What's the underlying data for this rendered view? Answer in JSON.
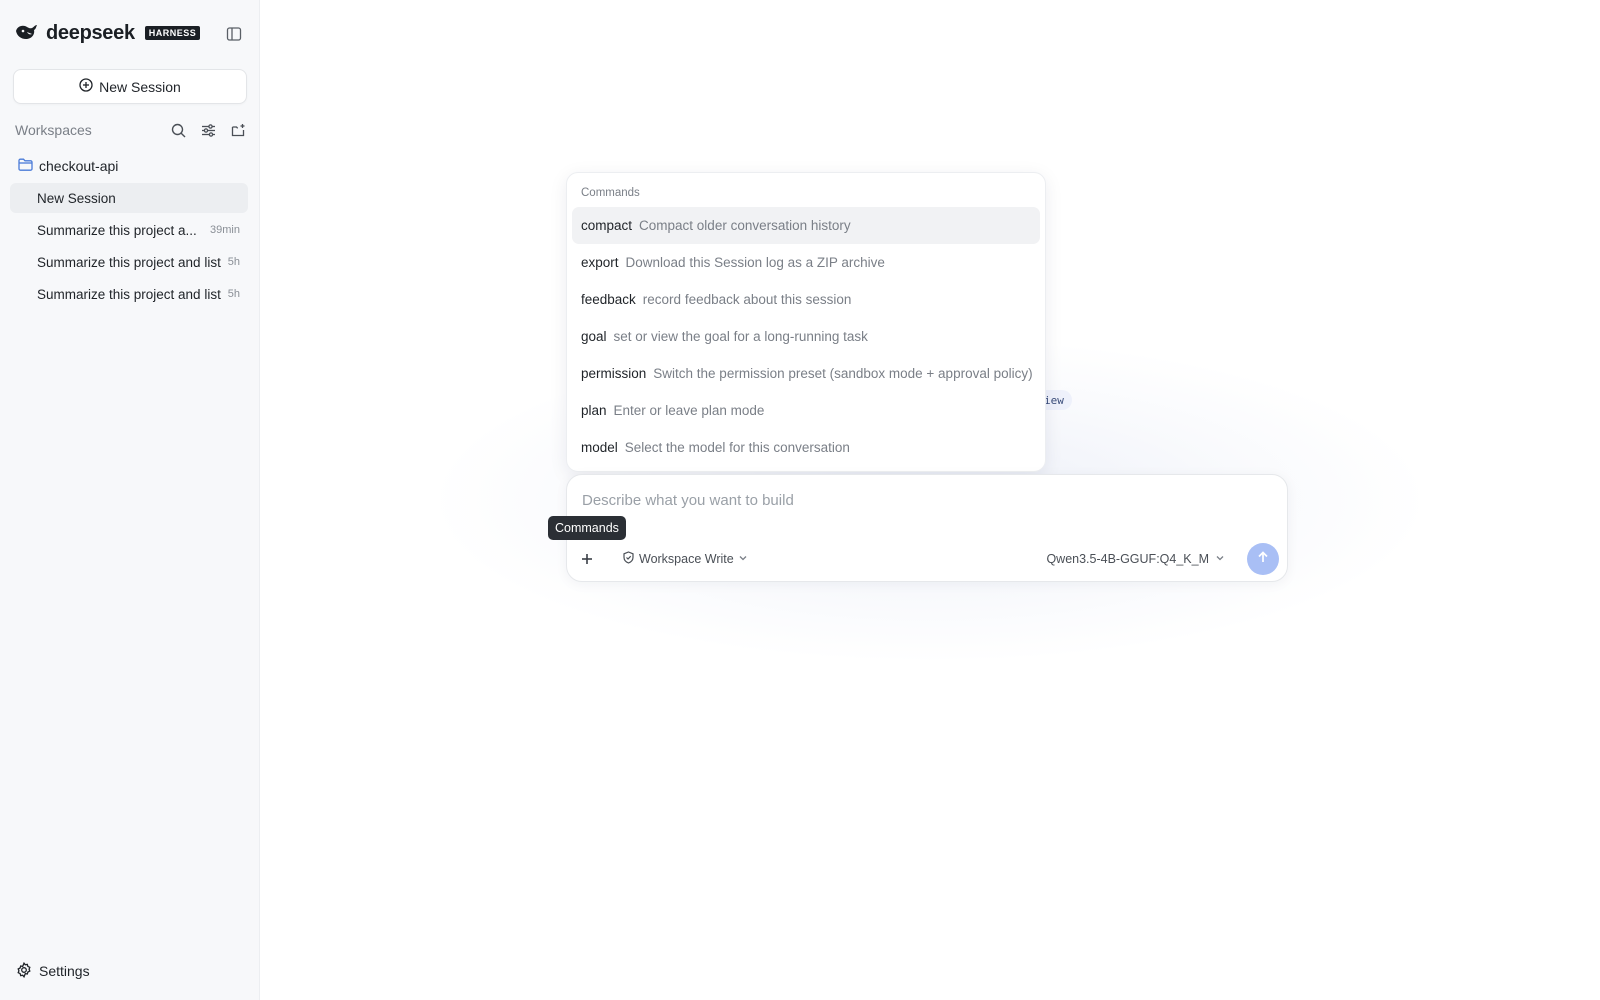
{
  "brand": {
    "name": "deepseek",
    "badge": "HARNESS"
  },
  "sidebar": {
    "new_session_label": "New Session",
    "workspaces_label": "Workspaces",
    "folder": "checkout-api",
    "sessions": [
      {
        "label": "New Session",
        "time": ""
      },
      {
        "label": "Summarize this project a...",
        "time": "39min"
      },
      {
        "label": "Summarize this project and list",
        "time": "5h"
      },
      {
        "label": "Summarize this project and list",
        "time": "5h"
      }
    ],
    "settings_label": "Settings"
  },
  "commands": {
    "heading": "Commands",
    "items": [
      {
        "name": "compact",
        "desc": "Compact older conversation history"
      },
      {
        "name": "export",
        "desc": "Download this Session log as a ZIP archive"
      },
      {
        "name": "feedback",
        "desc": "record feedback about this session"
      },
      {
        "name": "goal",
        "desc": "set or view the goal for a long-running task"
      },
      {
        "name": "permission",
        "desc": "Switch the permission preset (sandbox mode + approval policy)"
      },
      {
        "name": "plan",
        "desc": "Enter or leave plan mode"
      },
      {
        "name": "model",
        "desc": "Select the model for this conversation"
      }
    ]
  },
  "ghost_chip": "iew",
  "composer": {
    "placeholder": "Describe what you want to build",
    "permission": "Workspace Write",
    "model": "Qwen3.5-4B-GGUF:Q4_K_M"
  },
  "tooltip": "Commands",
  "colors": {
    "accent": "#a9bff5",
    "folder_icon": "#4a7bd8"
  },
  "icons": {
    "brand": "whale-icon",
    "collapse": "sidebar-toggle-icon",
    "new_session": "plus-circle-icon",
    "search": "search-icon",
    "filter": "sliders-icon",
    "new_folder": "folder-plus-icon",
    "folder": "folder-icon",
    "settings": "gear-icon",
    "permission": "shield-icon",
    "chevron": "chevron-down-icon",
    "send": "arrow-up-icon",
    "plus": "plus-icon"
  }
}
